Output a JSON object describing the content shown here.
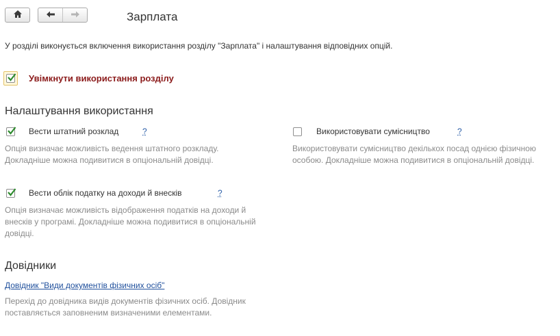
{
  "header": {
    "title": "Зарплата",
    "home_icon": "home-icon",
    "back_icon": "arrow-left-icon",
    "forward_icon": "arrow-right-icon"
  },
  "intro": "У розділі виконується включення використання розділу \"Зарплата\" і налаштування відповідних опцій.",
  "main_toggle": {
    "label": "Увімкнути використання розділу",
    "checked": true
  },
  "settings": {
    "heading": "Налаштування використання",
    "options": [
      {
        "label": "Вести штатний розклад",
        "help": "?",
        "checked": true,
        "desc1": "Опція визначає можливість ведення штатного розкладу.",
        "desc2": "Докладніше можна подивитися в опціональній довідці."
      },
      {
        "label": "Використовувати сумісництво",
        "help": "?",
        "checked": false,
        "desc1": "Використовувати сумісництво декількох посад однією фізичною",
        "desc2": "особою. Докладніше можна подивитися в опціональній довідці."
      },
      {
        "label": "Вести облік податку на доходи й внесків",
        "help": "?",
        "checked": true,
        "desc1": "Опція визначає можливість відображення податків на доходи й",
        "desc2": "внесків у програмі. Докладніше можна подивитися в опціональній",
        "desc3": "довідці."
      }
    ]
  },
  "references": {
    "heading": "Довідники",
    "link": "Довідник \"Види документів фізичних осіб\"",
    "desc1": "Перехід до довідника видів документів фізичних осіб. Довідник",
    "desc2": "поставляється заповненим визначеними елементами."
  },
  "colors": {
    "main_label": "#8b1b1b",
    "check": "#2e8b2e",
    "link": "#1f4f9c",
    "desc": "#8a8a8a"
  }
}
